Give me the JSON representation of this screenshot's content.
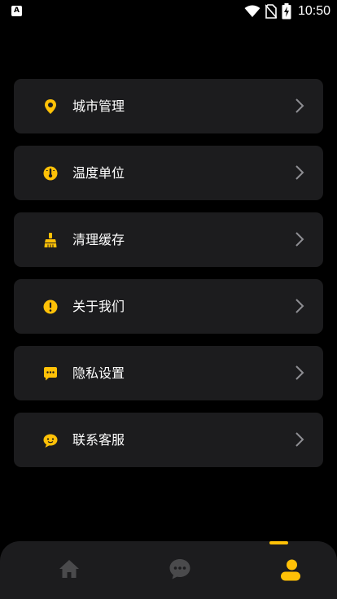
{
  "status_bar": {
    "app_badge": "A",
    "time": "10:50",
    "icons": [
      "wifi-icon",
      "no-sim-icon",
      "battery-charging-icon"
    ]
  },
  "menu": {
    "items": [
      {
        "label": "城市管理",
        "icon": "location-pin-icon"
      },
      {
        "label": "温度单位",
        "icon": "thermometer-dial-icon"
      },
      {
        "label": "清理缓存",
        "icon": "broom-icon"
      },
      {
        "label": "关于我们",
        "icon": "info-exclamation-icon"
      },
      {
        "label": "隐私设置",
        "icon": "message-dots-icon"
      },
      {
        "label": "联系客服",
        "icon": "customer-service-icon"
      }
    ]
  },
  "tabbar": {
    "tabs": [
      {
        "name": "home",
        "icon": "home-icon",
        "active": false
      },
      {
        "name": "chat",
        "icon": "chat-bubble-icon",
        "active": false
      },
      {
        "name": "profile",
        "icon": "user-icon",
        "active": true
      }
    ]
  },
  "colors": {
    "background": "#000000",
    "card": "#1c1c1e",
    "accent": "#ffc107",
    "inactive_icon": "#4a4a4c",
    "chevron": "#8e8e93"
  }
}
